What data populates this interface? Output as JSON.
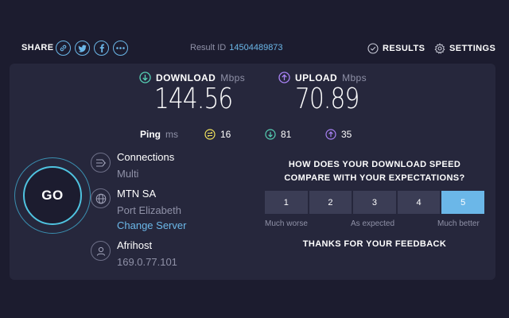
{
  "header": {
    "share_label": "SHARE",
    "share_icons": [
      "link-icon",
      "twitter-icon",
      "facebook-icon",
      "more-icon"
    ],
    "result_label": "Result ID",
    "result_id": "14504489873",
    "results_label": "RESULTS",
    "settings_label": "SETTINGS"
  },
  "download": {
    "label": "DOWNLOAD",
    "unit": "Mbps",
    "value": "144.56",
    "color": "#56d0b4"
  },
  "upload": {
    "label": "UPLOAD",
    "unit": "Mbps",
    "value": "70.89",
    "color": "#a982f5"
  },
  "ping": {
    "label": "Ping",
    "unit": "ms",
    "idle": "16",
    "download": "81",
    "upload": "35"
  },
  "go_label": "GO",
  "connections": {
    "title": "Connections",
    "value": "Multi"
  },
  "server": {
    "name": "MTN SA",
    "location": "Port Elizabeth",
    "change_label": "Change Server"
  },
  "provider": {
    "name": "Afrihost",
    "ip": "169.0.77.101"
  },
  "feedback": {
    "question": "HOW DOES YOUR DOWNLOAD SPEED COMPARE WITH YOUR EXPECTATIONS?",
    "ratings": [
      "1",
      "2",
      "3",
      "4",
      "5"
    ],
    "selected": "5",
    "low_label": "Much worse",
    "mid_label": "As expected",
    "high_label": "Much better",
    "thanks": "THANKS FOR YOUR FEEDBACK"
  },
  "colors": {
    "accent": "#6bb7e8",
    "background": "#1c1c2f",
    "panel": "#26273c",
    "ping_idle": "#f2e35d"
  }
}
